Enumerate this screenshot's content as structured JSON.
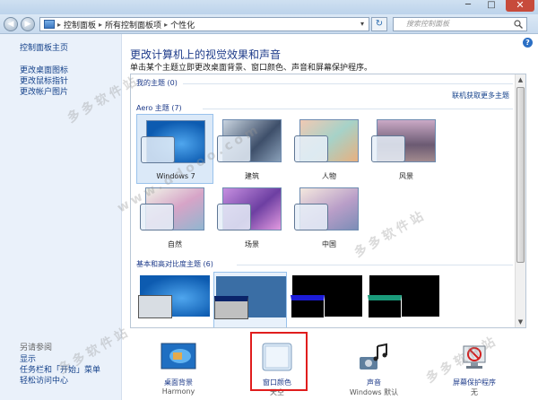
{
  "window": {
    "minimize": "─",
    "maximize": "□",
    "close": "✕"
  },
  "address": {
    "back": "◀",
    "forward": "▶",
    "crumbs": [
      "控制面板",
      "所有控制面板项",
      "个性化"
    ],
    "separator": "▸",
    "dropdown": "▾",
    "refresh": "↻",
    "search_placeholder": "搜索控制面板"
  },
  "sidebar": {
    "home": "控制面板主页",
    "links": [
      "更改桌面图标",
      "更改鼠标指针",
      "更改帐户图片"
    ],
    "see_also_title": "另请参阅",
    "see_also": [
      "显示",
      "任务栏和「开始」菜单",
      "轻松访问中心"
    ]
  },
  "main": {
    "help": "?",
    "title": "更改计算机上的视觉效果和声音",
    "description": "单击某个主题立即更改桌面背景、窗口颜色、声音和屏幕保护程序。",
    "my_themes": "我的主题 (0)",
    "online_link": "联机获取更多主题",
    "aero_group": "Aero 主题 (7)",
    "aero_themes": [
      {
        "name": "Windows 7",
        "key": "win7"
      },
      {
        "name": "建筑",
        "key": "arch"
      },
      {
        "name": "人物",
        "key": "people"
      },
      {
        "name": "风景",
        "key": "land"
      },
      {
        "name": "自然",
        "key": "nature"
      },
      {
        "name": "场景",
        "key": "scene"
      },
      {
        "name": "中国",
        "key": "china"
      }
    ],
    "basic_group": "基本和高对比度主题 (6)",
    "scroll_up": "▲",
    "scroll_down": "▼"
  },
  "bottom": {
    "items": [
      {
        "label": "桌面背景",
        "value": "Harmony",
        "icon": "desktop-background-icon"
      },
      {
        "label": "窗口颜色",
        "value": "天空",
        "icon": "window-color-icon"
      },
      {
        "label": "声音",
        "value": "Windows 默认",
        "icon": "sound-icon"
      },
      {
        "label": "屏幕保护程序",
        "value": "无",
        "icon": "screensaver-icon"
      }
    ]
  },
  "watermarks": [
    "多多软件站",
    "www.ddooo.com",
    "多多软件站",
    "多多软件站",
    "多多软件站"
  ],
  "colors": {
    "link": "#15428b",
    "title": "#1e3b8a",
    "highlight": "#e01d1d",
    "sidebar_bg": "#eaf1fa"
  }
}
